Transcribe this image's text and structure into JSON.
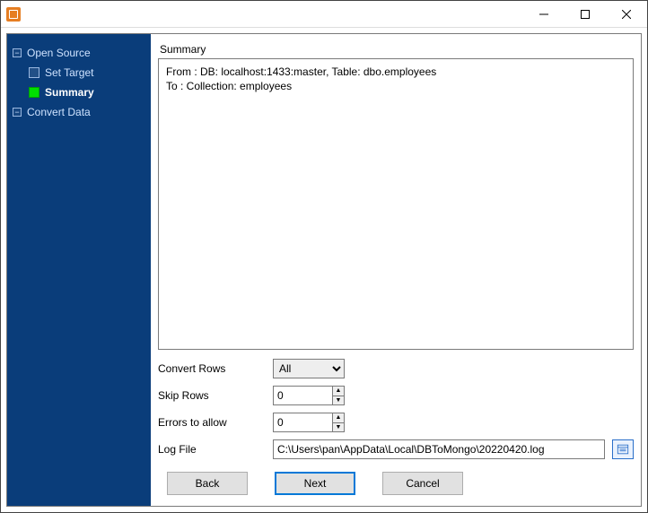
{
  "window": {
    "title": ""
  },
  "sidebar": {
    "items": [
      {
        "label": "Open Source",
        "active": false,
        "child": false
      },
      {
        "label": "Set Target",
        "active": false,
        "child": true
      },
      {
        "label": "Summary",
        "active": true,
        "child": true
      },
      {
        "label": "Convert Data",
        "active": false,
        "child": false
      }
    ]
  },
  "main": {
    "summary_title": "Summary",
    "summary_text": "From : DB: localhost:1433:master, Table: dbo.employees\nTo : Collection: employees",
    "form": {
      "convert_rows_label": "Convert Rows",
      "convert_rows_value": "All",
      "skip_rows_label": "Skip Rows",
      "skip_rows_value": "0",
      "errors_allow_label": "Errors to allow",
      "errors_allow_value": "0",
      "log_file_label": "Log File",
      "log_file_value": "C:\\Users\\pan\\AppData\\Local\\DBToMongo\\20220420.log"
    },
    "buttons": {
      "back": "Back",
      "next": "Next",
      "cancel": "Cancel"
    }
  }
}
